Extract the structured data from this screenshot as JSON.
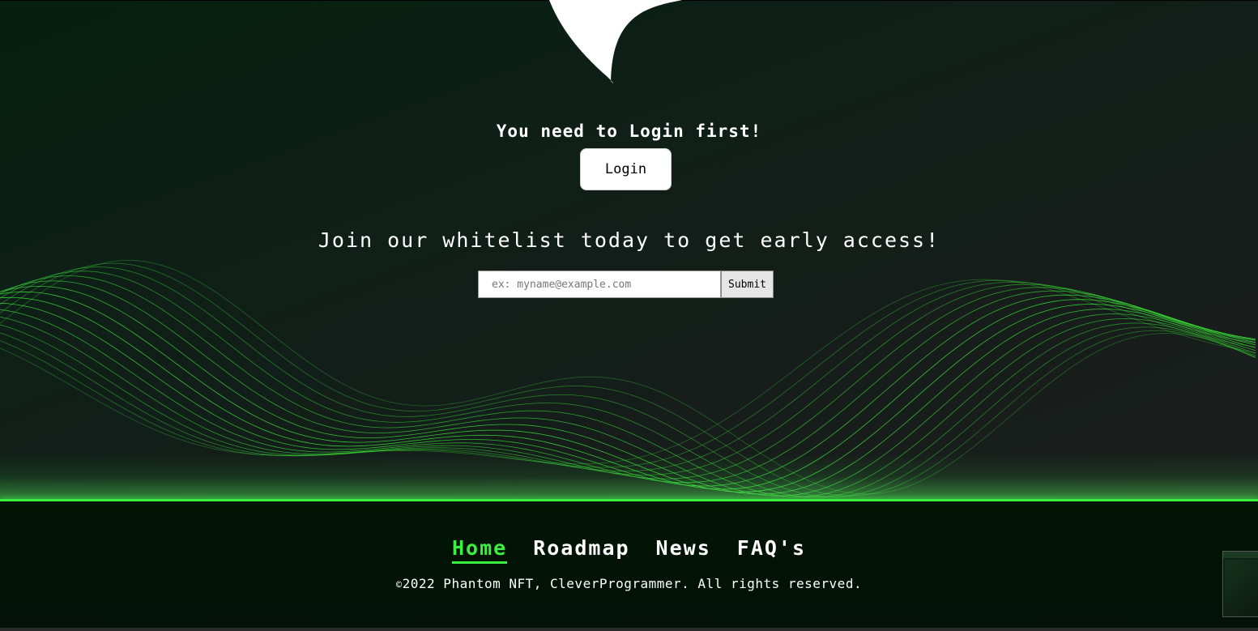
{
  "hero": {
    "login_message": "You need to Login first!",
    "login_button": "Login",
    "whitelist_heading": "Join our whitelist today to get early access!",
    "email_placeholder": "ex: myname@example.com",
    "email_value": "",
    "submit_button": "Submit"
  },
  "footer": {
    "nav": [
      {
        "label": "Home",
        "active": true
      },
      {
        "label": "Roadmap",
        "active": false
      },
      {
        "label": "News",
        "active": false
      },
      {
        "label": "FAQ's",
        "active": false
      }
    ],
    "copyright_symbol": "©",
    "copyright_text": "2022 Phantom NFT, CleverProgrammer. All rights reserved."
  },
  "colors": {
    "accent": "#3cf03f",
    "hero_bg": "#0f1f18",
    "footer_bg": "#021505"
  },
  "icons": {
    "logo": "phantom-ghost-logo-icon"
  }
}
